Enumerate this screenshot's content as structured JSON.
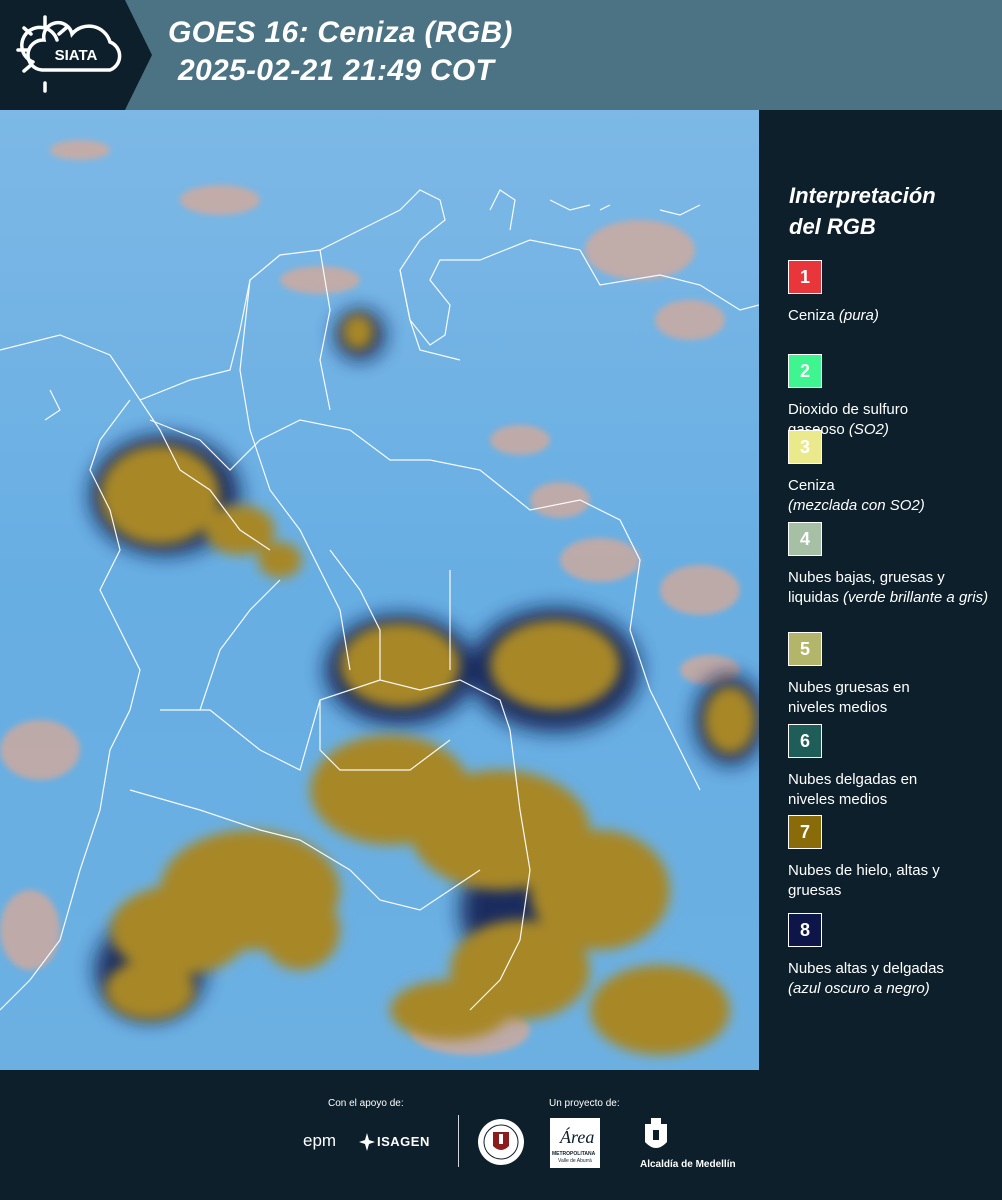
{
  "header": {
    "logo_text": "SIATA",
    "title_line1": "GOES 16: Ceniza (RGB)",
    "title_line2": "2025-02-21 21:49 COT"
  },
  "legend": {
    "heading_line1": "Interpretación",
    "heading_line2": "del RGB",
    "items": [
      {
        "num": "1",
        "color": "#e8363a",
        "text1": "Ceniza",
        "text2": "",
        "italic": "(pura)"
      },
      {
        "num": "2",
        "color": "#3ff58f",
        "text1": "Dioxido de sulfuro",
        "text2": "gaseoso",
        "italic": "(SO2)"
      },
      {
        "num": "3",
        "color": "#eaea8c",
        "text1": "Ceniza",
        "text2": "",
        "italic": "(mezclada con SO2)"
      },
      {
        "num": "4",
        "color": "#a6c0a5",
        "text1": "Nubes bajas, gruesas y",
        "text2": "liquidas",
        "italic": "(verde brillante a gris)"
      },
      {
        "num": "5",
        "color": "#b3b56a",
        "text1": "Nubes gruesas en",
        "text2": "niveles medios",
        "italic": ""
      },
      {
        "num": "6",
        "color": "#1e5d58",
        "text1": "Nubes delgadas en",
        "text2": "niveles medios",
        "italic": ""
      },
      {
        "num": "7",
        "color": "#8a6b0a",
        "text1": "Nubes de hielo, altas y",
        "text2": "gruesas",
        "italic": ""
      },
      {
        "num": "8",
        "color": "#0e1548",
        "text1": "Nubes altas y delgadas",
        "text2": "",
        "italic": "(azul oscuro a negro)"
      }
    ]
  },
  "footer": {
    "support_label": "Con el apoyo de:",
    "project_label": "Un proyecto de:",
    "epm": "epm",
    "isagen": "ISAGEN",
    "area_text": "Área",
    "metropolitana": "METROPOLITANA",
    "valle": "Valle de Aburrá",
    "alcaldia": "Alcaldía de Medellín"
  }
}
